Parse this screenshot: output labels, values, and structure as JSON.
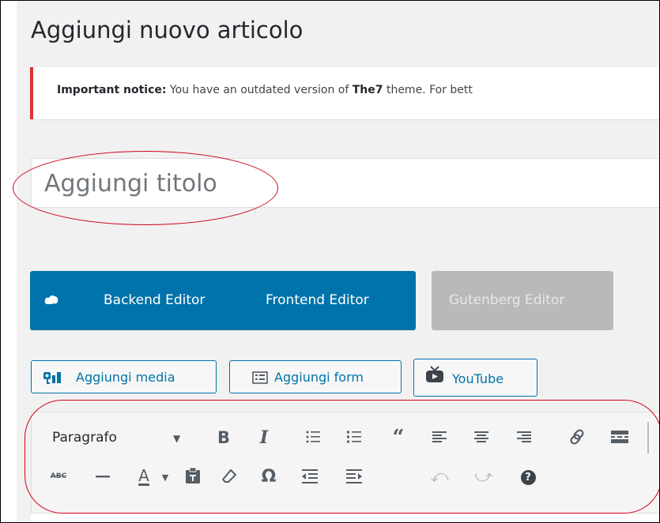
{
  "page": {
    "title": "Aggiungi nuovo articolo"
  },
  "notice": {
    "prefix": "Important notice:",
    "text_before_theme": " You have an outdated version of ",
    "theme": "The7",
    "text_after_theme": " theme. For bett"
  },
  "title_field": {
    "placeholder": "Aggiungi titolo"
  },
  "editor_switch": {
    "backend_label": "Backend Editor",
    "frontend_label": "Frontend Editor",
    "gutenberg_label": "Gutenberg Editor"
  },
  "media_buttons": {
    "add_media": "Aggiungi media",
    "add_form": "Aggiungi form",
    "youtube": "YouTube"
  },
  "toolbar": {
    "format_select_value": "Paragrafo",
    "bold": "B",
    "italic": "I",
    "text_color": "A",
    "special_chars": "Ω",
    "help": "?",
    "strikethrough": "ABC"
  },
  "colors": {
    "accent": "#0073aa",
    "notice_border": "#dc3232",
    "annotation": "#d0021b",
    "disabled_button": "#b9b9b9"
  }
}
